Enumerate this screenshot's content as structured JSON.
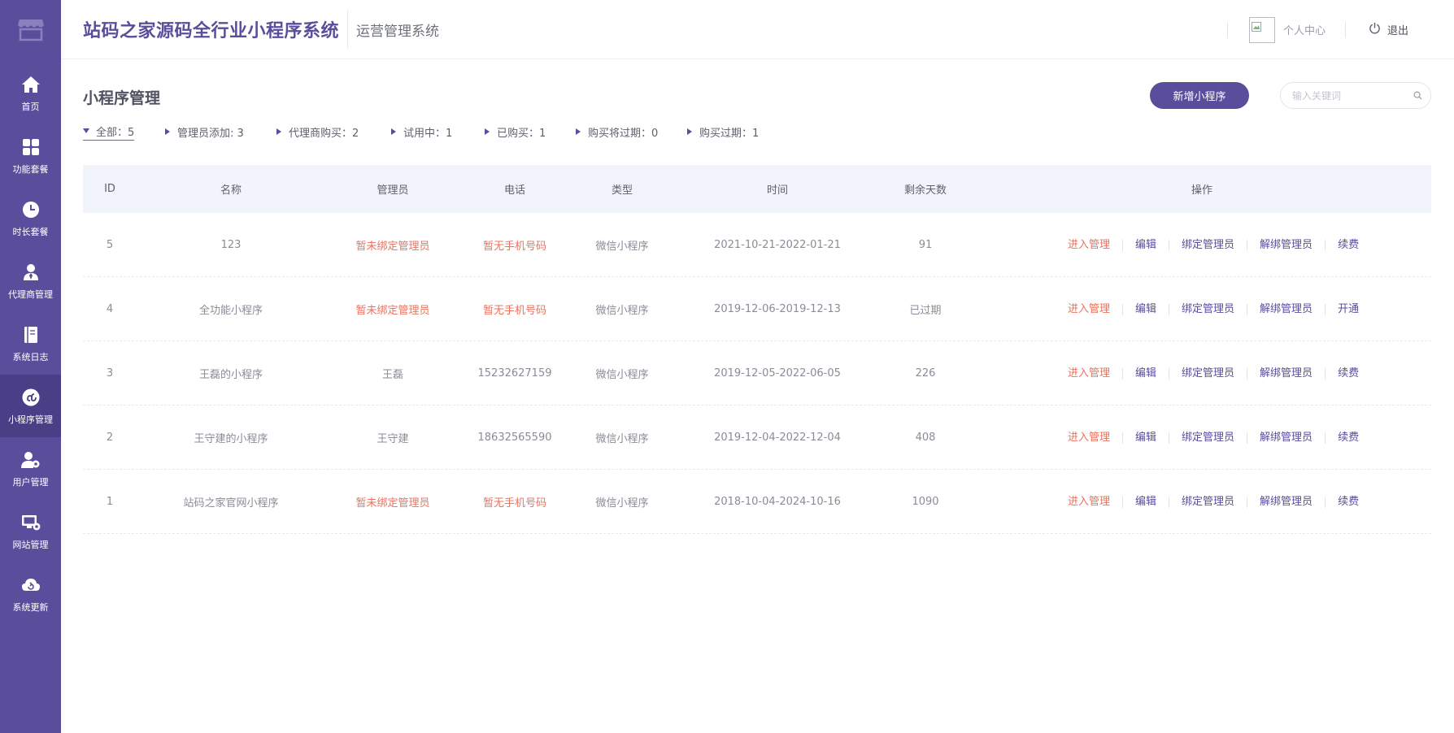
{
  "app": {
    "title": "站码之家源码全行业小程序系统",
    "subtitle": "运营管理系统"
  },
  "header": {
    "profile_label": "个人中心",
    "logout_label": "退出"
  },
  "sidebar": {
    "logo_icon": "store-icon",
    "items": [
      {
        "label": "首页",
        "icon": "home-icon",
        "active": false
      },
      {
        "label": "功能套餐",
        "icon": "grid-icon",
        "active": false
      },
      {
        "label": "时长套餐",
        "icon": "clock-icon",
        "active": false
      },
      {
        "label": "代理商管理",
        "icon": "agent-icon",
        "active": false
      },
      {
        "label": "系统日志",
        "icon": "log-book-icon",
        "active": false
      },
      {
        "label": "小程序管理",
        "icon": "miniprogram-icon",
        "active": true
      },
      {
        "label": "用户管理",
        "icon": "user-settings-icon",
        "active": false
      },
      {
        "label": "网站管理",
        "icon": "website-settings-icon",
        "active": false
      },
      {
        "label": "系统更新",
        "icon": "cloud-update-icon",
        "active": false
      }
    ]
  },
  "page": {
    "title": "小程序管理",
    "add_button": "新增小程序",
    "search_placeholder": "输入关键词"
  },
  "filters": [
    {
      "label": "全部：5",
      "active": true
    },
    {
      "label": "管理员添加: 3",
      "active": false
    },
    {
      "label": "代理商购买：2",
      "active": false
    },
    {
      "label": "试用中：1",
      "active": false
    },
    {
      "label": "已购买：1",
      "active": false
    },
    {
      "label": "购买将过期：0",
      "active": false
    },
    {
      "label": "购买过期：1",
      "active": false
    }
  ],
  "table": {
    "headers": [
      "ID",
      "名称",
      "管理员",
      "电话",
      "类型",
      "时间",
      "剩余天数",
      "操作"
    ],
    "rows": [
      {
        "id": "5",
        "name": "123",
        "admin": "暂未绑定管理员",
        "admin_unbound": true,
        "phone": "暂无手机号码",
        "phone_missing": true,
        "type": "微信小程序",
        "time": "2021-10-21-2022-01-21",
        "days": "91",
        "last_action": "续费"
      },
      {
        "id": "4",
        "name": "全功能小程序",
        "admin": "暂未绑定管理员",
        "admin_unbound": true,
        "phone": "暂无手机号码",
        "phone_missing": true,
        "type": "微信小程序",
        "time": "2019-12-06-2019-12-13",
        "days": "已过期",
        "last_action": "开通"
      },
      {
        "id": "3",
        "name": "王磊的小程序",
        "admin": "王磊",
        "admin_unbound": false,
        "phone": "15232627159",
        "phone_missing": false,
        "type": "微信小程序",
        "time": "2019-12-05-2022-06-05",
        "days": "226",
        "last_action": "续费"
      },
      {
        "id": "2",
        "name": "王守建的小程序",
        "admin": "王守建",
        "admin_unbound": false,
        "phone": "18632565590",
        "phone_missing": false,
        "type": "微信小程序",
        "time": "2019-12-04-2022-12-04",
        "days": "408",
        "last_action": "续费"
      },
      {
        "id": "1",
        "name": "站码之家官网小程序",
        "admin": "暂未绑定管理员",
        "admin_unbound": true,
        "phone": "暂无手机号码",
        "phone_missing": true,
        "type": "微信小程序",
        "time": "2018-10-04-2024-10-16",
        "days": "1090",
        "last_action": "续费"
      }
    ],
    "actions": [
      "进入管理",
      "编辑",
      "绑定管理员",
      "解绑管理员"
    ]
  },
  "colors": {
    "brand": "#5a4d9c",
    "accent_red": "#e8735f",
    "table_header_bg": "#f1f4fb"
  }
}
